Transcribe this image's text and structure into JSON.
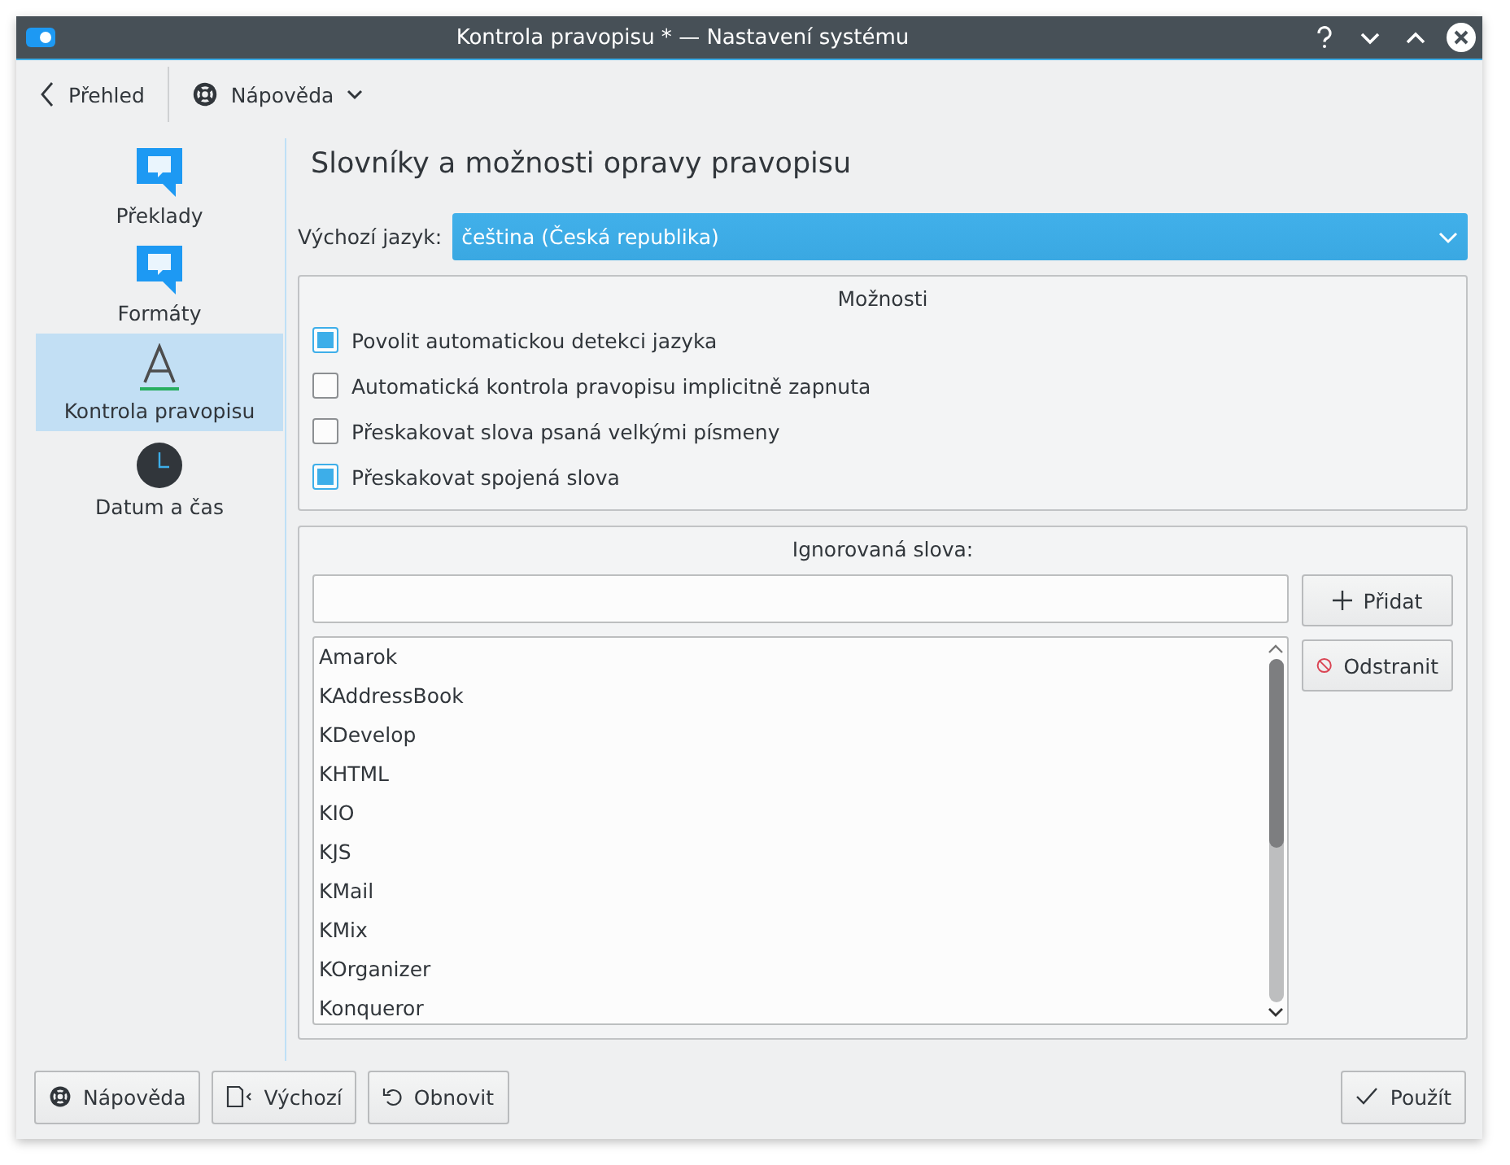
{
  "window": {
    "title": "Kontrola pravopisu * — Nastavení systému"
  },
  "toolbar": {
    "back": "Přehled",
    "help": "Nápověda"
  },
  "sidebar": {
    "items": [
      {
        "label": "Překlady",
        "selected": false
      },
      {
        "label": "Formáty",
        "selected": false
      },
      {
        "label": "Kontrola pravopisu",
        "selected": true
      },
      {
        "label": "Datum a čas",
        "selected": false
      }
    ]
  },
  "heading": "Slovníky a možnosti opravy pravopisu",
  "language": {
    "label": "Výchozí jazyk:",
    "value": "čeština (Česká republika)"
  },
  "options": {
    "title": "Možnosti",
    "items": [
      {
        "label": "Povolit automatickou detekci jazyka",
        "checked": true
      },
      {
        "label": "Automatická kontrola pravopisu implicitně zapnuta",
        "checked": false
      },
      {
        "label": "Přeskakovat slova psaná velkými písmeny",
        "checked": false
      },
      {
        "label": "Přeskakovat spojená slova",
        "checked": true
      }
    ]
  },
  "ignored": {
    "title": "Ignorovaná slova:",
    "add": "Přidat",
    "remove": "Odstranit",
    "words": [
      "Amarok",
      "KAddressBook",
      "KDevelop",
      "KHTML",
      "KIO",
      "KJS",
      "KMail",
      "KMix",
      "KOrganizer",
      "Konqueror"
    ]
  },
  "buttons": [
    {
      "label": "Nápověda"
    },
    {
      "label": "Výchozí"
    },
    {
      "label": "Obnovit"
    },
    {
      "label": "Použít"
    }
  ]
}
